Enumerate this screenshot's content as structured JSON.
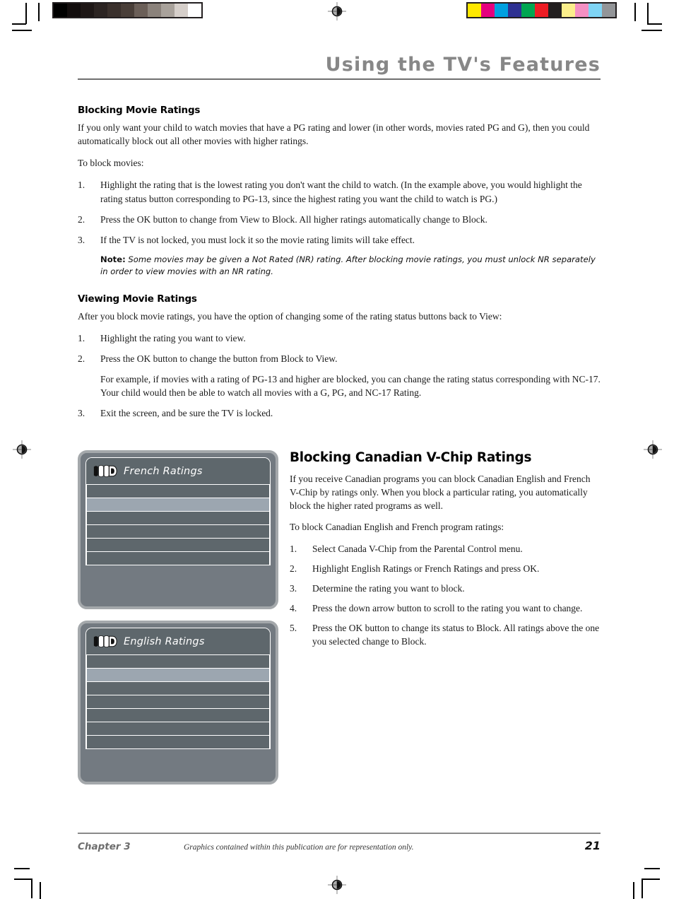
{
  "header": {
    "title": "Using the TV's Features"
  },
  "sections": {
    "blocking_movie": {
      "heading": "Blocking Movie Ratings",
      "intro": "If you only want your child to watch movies that have a PG rating and lower (in other words, movies rated PG and G), then you could automatically block out all other movies with higher ratings.",
      "lead": "To block movies:",
      "steps": [
        {
          "num": "1.",
          "text_parts": [
            {
              "t": "Highlight the rating that is the lowest rating you don't want the child to watch. (In the example above, you would highlight the rating status button corresponding to PG-13, since the highest rating you want the child to watch is PG.)",
              "style": "normal"
            }
          ]
        },
        {
          "num": "2.",
          "text_parts": [
            {
              "t": "Press the OK button to change from ",
              "style": "normal"
            },
            {
              "t": "View",
              "style": "italic"
            },
            {
              "t": " to ",
              "style": "normal"
            },
            {
              "t": "Block",
              "style": "italic"
            },
            {
              "t": ". All higher ratings automatically change to ",
              "style": "normal"
            },
            {
              "t": "Block",
              "style": "italic"
            },
            {
              "t": ".",
              "style": "normal"
            }
          ]
        },
        {
          "num": "3.",
          "text_parts": [
            {
              "t": "If the TV is not locked, you must lock it so the movie rating limits will take effect.",
              "style": "normal"
            }
          ]
        }
      ],
      "note_label": "Note:",
      "note_text": " Some movies may be given a Not Rated (NR) rating. After blocking movie ratings, you must unlock NR separately in order to view movies with an NR rating."
    },
    "viewing_movie": {
      "heading": "Viewing Movie Ratings",
      "intro_parts": [
        {
          "t": "After you block movie ratings, you have the option of changing some of the rating status buttons back to ",
          "style": "normal"
        },
        {
          "t": "View",
          "style": "italic"
        },
        {
          "t": ":",
          "style": "normal"
        }
      ],
      "steps": [
        {
          "num": "1.",
          "text_parts": [
            {
              "t": "Highlight the rating you want to view.",
              "style": "normal"
            }
          ]
        },
        {
          "num": "2.",
          "text_parts": [
            {
              "t": "Press the OK button to change the button from ",
              "style": "normal"
            },
            {
              "t": "Block",
              "style": "italic"
            },
            {
              "t": " to ",
              "style": "normal"
            },
            {
              "t": "View",
              "style": "italic"
            },
            {
              "t": ".",
              "style": "normal"
            }
          ]
        },
        {
          "num": "3.",
          "text_parts": [
            {
              "t": "Exit the screen, and be sure the TV is locked.",
              "style": "normal"
            }
          ]
        }
      ],
      "example_para": "For example, if movies with a rating of PG-13 and higher are blocked, you can change the rating status corresponding with NC-17. Your child would then be able to watch all movies with a G, PG, and NC-17 Rating."
    },
    "canadian_vchip": {
      "heading": "Blocking Canadian V-Chip Ratings",
      "intro": "If you receive Canadian programs you can block Canadian English and French V-Chip by ratings only. When you block a particular rating, you automatically block the higher rated programs as well.",
      "lead": "To block Canadian English and French program ratings:",
      "steps": [
        {
          "num": "1.",
          "text_parts": [
            {
              "t": "Select ",
              "style": "normal"
            },
            {
              "t": "Canada V-Chip",
              "style": "italic"
            },
            {
              "t": " from the ",
              "style": "normal"
            },
            {
              "t": "Parental Control",
              "style": "italic"
            },
            {
              "t": " menu.",
              "style": "normal"
            }
          ]
        },
        {
          "num": "2.",
          "text_parts": [
            {
              "t": "Highlight ",
              "style": "normal"
            },
            {
              "t": "English Ratings",
              "style": "italic"
            },
            {
              "t": " or ",
              "style": "normal"
            },
            {
              "t": "French Ratings",
              "style": "italic"
            },
            {
              "t": " and press OK.",
              "style": "normal"
            }
          ]
        },
        {
          "num": "3.",
          "text_parts": [
            {
              "t": "Determine the rating you want to block.",
              "style": "normal"
            }
          ]
        },
        {
          "num": "4.",
          "text_parts": [
            {
              "t": "Press the down arrow button to scroll to the rating you want to change.",
              "style": "normal"
            }
          ]
        },
        {
          "num": "5.",
          "text_parts": [
            {
              "t": "Press the OK button to change its status to ",
              "style": "normal"
            },
            {
              "t": "Block",
              "style": "italic"
            },
            {
              "t": ". All ratings above the one you selected change to ",
              "style": "normal"
            },
            {
              "t": "Block",
              "style": "italic"
            },
            {
              "t": ".",
              "style": "normal"
            }
          ]
        }
      ]
    }
  },
  "tv_screens": [
    {
      "name": "french-ratings-screen",
      "title": "French Ratings",
      "logo_icon": "rca-swoosh-logo-icon",
      "row_count": 6,
      "highlighted_row_index": 1,
      "rows": [
        "",
        "",
        "",
        "",
        "",
        ""
      ],
      "colors": {
        "bezel": "#a4a8ab",
        "screen_bg": "#737a81",
        "row_bg": "#5e676c",
        "row_highlight": "#9ca6b0",
        "row_border": "#ffffff",
        "title_text": "#ffffff"
      }
    },
    {
      "name": "english-ratings-screen",
      "title": "English Ratings",
      "logo_icon": "rca-swoosh-logo-icon",
      "row_count": 7,
      "highlighted_row_index": 1,
      "rows": [
        "",
        "",
        "",
        "",
        "",
        "",
        ""
      ],
      "colors": {
        "bezel": "#a4a8ab",
        "screen_bg": "#737a81",
        "row_bg": "#5e676c",
        "row_highlight": "#9ca6b0",
        "row_border": "#ffffff",
        "title_text": "#ffffff"
      }
    }
  ],
  "footer": {
    "chapter": "Chapter 3",
    "disclaimer": "Graphics contained within this publication are for representation only.",
    "page_number": "21"
  },
  "print_marks": {
    "grayscale_strip": [
      "#000000",
      "#120d0d",
      "#1e1716",
      "#2c2422",
      "#3a302c",
      "#4a3f39",
      "#6b5f58",
      "#8b827b",
      "#a9a29b",
      "#d6cfca",
      "#ffffff"
    ],
    "color_strip": [
      "#ffe800",
      "#e5007e",
      "#00a0e0",
      "#2e3192",
      "#00a651",
      "#ed1c24",
      "#231f20",
      "#fbee8b",
      "#f490c3",
      "#7fd4f4",
      "#939598"
    ]
  }
}
